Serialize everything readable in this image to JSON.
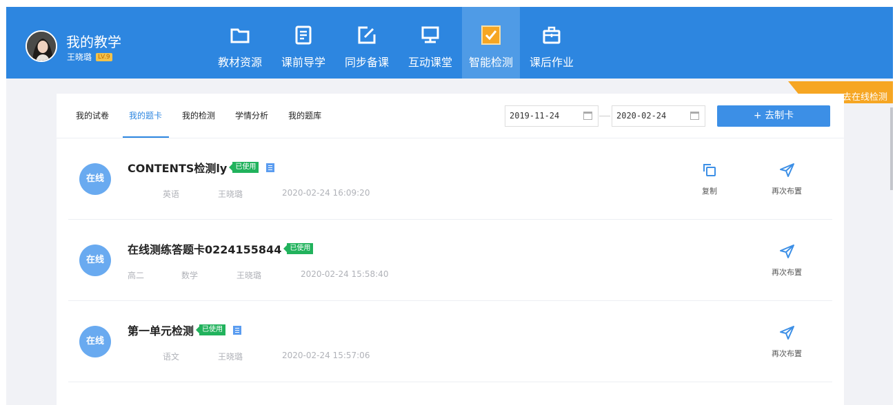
{
  "header": {
    "title": "我的教学",
    "user_name": "王晓璐",
    "level_badge": "LV.9"
  },
  "nav": [
    {
      "label": "教材资源",
      "icon": "folder-icon"
    },
    {
      "label": "课前导学",
      "icon": "document-icon"
    },
    {
      "label": "同步备课",
      "icon": "edit-icon"
    },
    {
      "label": "互动课堂",
      "icon": "monitor-icon"
    },
    {
      "label": "智能检测",
      "icon": "checkbox-icon",
      "active": true
    },
    {
      "label": "课后作业",
      "icon": "briefcase-icon"
    }
  ],
  "ribbon": {
    "label": "去在线检测"
  },
  "subtabs": [
    {
      "label": "我的试卷"
    },
    {
      "label": "我的题卡",
      "active": true
    },
    {
      "label": "我的检测"
    },
    {
      "label": "学情分析"
    },
    {
      "label": "我的题库"
    }
  ],
  "filters": {
    "start_date": "2019-11-24",
    "end_date": "2020-02-24",
    "make_card_label": "+ 去制卡"
  },
  "rows": [
    {
      "badge": "在线",
      "title": "CONTENTS检测ly",
      "status": "已使用",
      "has_doc_icon": true,
      "grade": "",
      "subject": "英语",
      "teacher": "王晓璐",
      "datetime": "2020-02-24 16:09:20",
      "copy_label": "复制",
      "reassign_label": "再次布置"
    },
    {
      "badge": "在线",
      "title": "在线测练答题卡0224155844",
      "status": "已使用",
      "has_doc_icon": false,
      "grade": "高二",
      "subject": "数学",
      "teacher": "王晓璐",
      "datetime": "2020-02-24 15:58:40",
      "copy_label": "",
      "reassign_label": "再次布置"
    },
    {
      "badge": "在线",
      "title": "第一单元检测",
      "status": "已使用",
      "has_doc_icon": true,
      "grade": "",
      "subject": "语文",
      "teacher": "王晓璐",
      "datetime": "2020-02-24 15:57:06",
      "copy_label": "",
      "reassign_label": "再次布置"
    }
  ],
  "colors": {
    "header_bg": "#2d86e0",
    "active_nav": "#4f9be6",
    "ribbon": "#f6a623",
    "used_tag": "#21b25c",
    "online_badge": "#69aaf0",
    "primary_button": "#3c8fe6"
  }
}
